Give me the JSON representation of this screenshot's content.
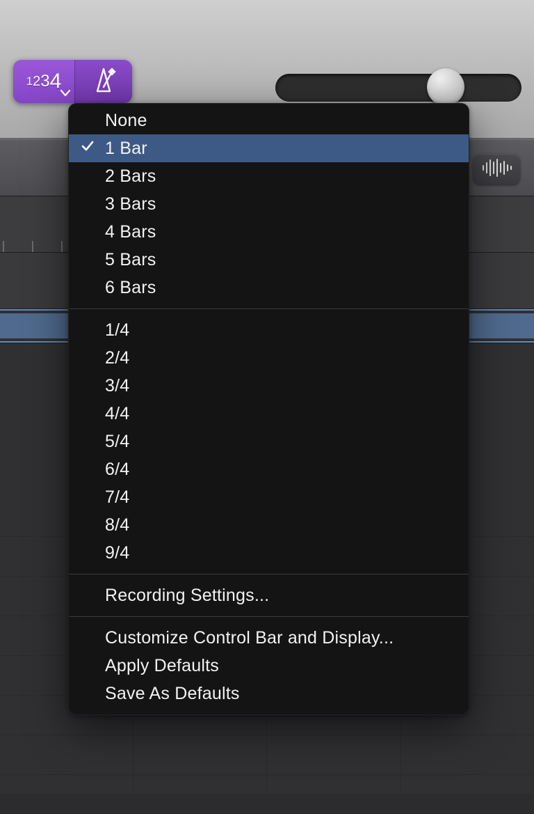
{
  "toolbar": {
    "countin_digits": [
      "1",
      "2",
      "3",
      "4"
    ],
    "slider_value": 0.64
  },
  "popup": {
    "group1": [
      {
        "label": "None",
        "selected": false
      },
      {
        "label": "1 Bar",
        "selected": true
      },
      {
        "label": "2 Bars",
        "selected": false
      },
      {
        "label": "3 Bars",
        "selected": false
      },
      {
        "label": "4 Bars",
        "selected": false
      },
      {
        "label": "5 Bars",
        "selected": false
      },
      {
        "label": "6 Bars",
        "selected": false
      }
    ],
    "group2": [
      {
        "label": "1/4"
      },
      {
        "label": "2/4"
      },
      {
        "label": "3/4"
      },
      {
        "label": "4/4"
      },
      {
        "label": "5/4"
      },
      {
        "label": "6/4"
      },
      {
        "label": "7/4"
      },
      {
        "label": "8/4"
      },
      {
        "label": "9/4"
      }
    ],
    "group3": [
      {
        "label": "Recording Settings..."
      }
    ],
    "group4": [
      {
        "label": "Customize Control Bar and Display..."
      },
      {
        "label": "Apply Defaults"
      },
      {
        "label": "Save As Defaults"
      }
    ]
  }
}
